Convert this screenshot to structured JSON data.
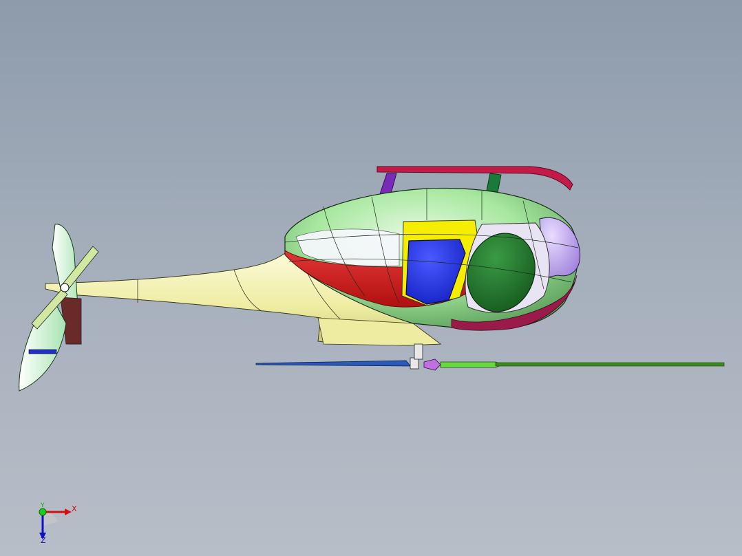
{
  "viewport": {
    "background_top": "#8d9bab",
    "background_bottom": "#b8bec8"
  },
  "model": {
    "colors": {
      "body_green": "#a8e8a0",
      "tail_boom_yellow": "#f4f2b0",
      "stripe_red": "#e01818",
      "door_blue": "#1a2ee8",
      "window_green": "#1e7a2a",
      "nose_purple": "#b090e0",
      "skid_crimson": "#c0184c",
      "frame_yellow": "#f6ee00",
      "rotor_green": "#3c8a1e",
      "rotor_blue": "#2a5ab8"
    }
  },
  "triad": {
    "x_label": "X",
    "y_label": "Y",
    "z_label": "Z",
    "x_color": "#d01010",
    "y_color": "#18a018",
    "z_color": "#1010c0"
  }
}
